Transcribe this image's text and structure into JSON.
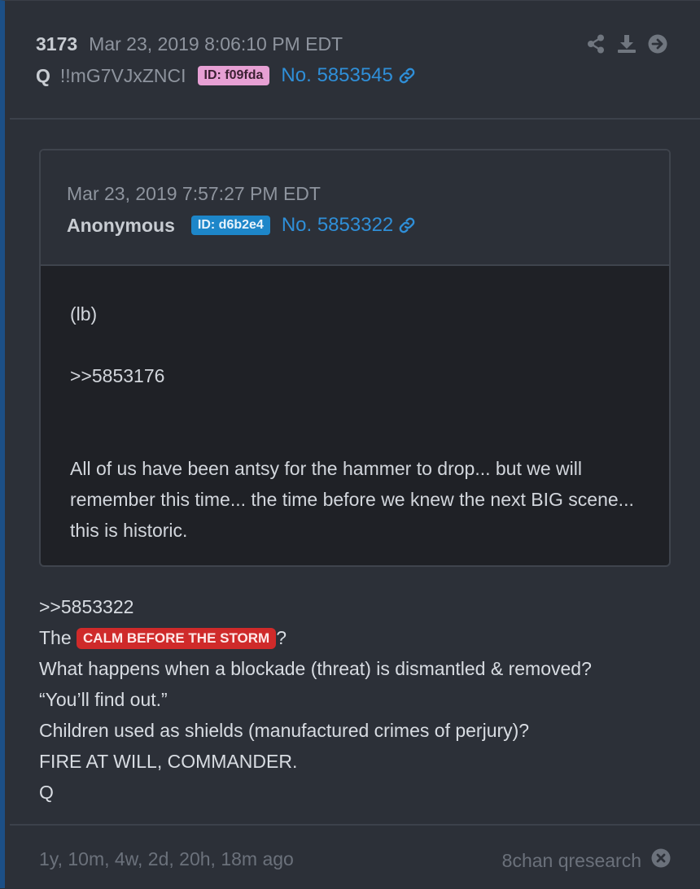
{
  "post": {
    "number": "3173",
    "timestamp": "Mar 23, 2019 8:06:10 PM EDT",
    "author": "Q",
    "tripcode": "!!mG7VJxZNCI",
    "id_label": "ID: f09fda",
    "post_link": "No. 5853545"
  },
  "quoted": {
    "timestamp": "Mar 23, 2019 7:57:27 PM EDT",
    "author": "Anonymous",
    "id_label": "ID: d6b2e4",
    "post_link": "No. 5853322",
    "lines": [
      "(lb)",
      "",
      ">>5853176",
      "",
      "",
      "All of us have been antsy for the hammer to drop... but we will remember this time... the time before we knew the next BIG scene... this is historic."
    ]
  },
  "body": {
    "line1": ">>5853322",
    "line2_prefix": "The ",
    "line2_tag": "CALM BEFORE THE STORM",
    "line2_suffix": "?",
    "line3": "What happens when a blockade (threat) is dismantled & removed?",
    "line4": "“You’ll find out.”",
    "line5": "Children used as shields (manufactured crimes of perjury)?",
    "line6": "FIRE AT WILL, COMMANDER.",
    "line7": "Q"
  },
  "footer": {
    "ago": "1y, 10m, 4w, 2d, 20h, 18m ago",
    "source": "8chan qresearch"
  },
  "colors": {
    "accent_link": "#2f8fd8",
    "id_pink": "#e7a0d4",
    "id_blue": "#1d86c9",
    "tag_red": "#cf2a2a"
  },
  "icons": [
    "share-icon",
    "download-icon",
    "arrow-circle-right-icon",
    "link-icon",
    "close-circle-icon"
  ]
}
